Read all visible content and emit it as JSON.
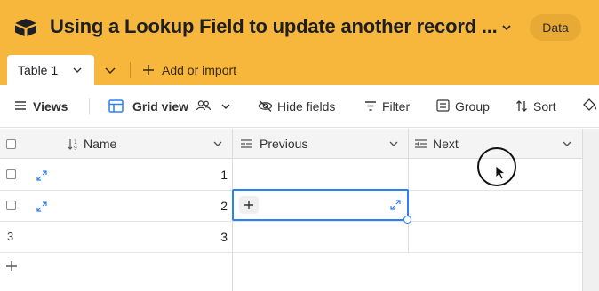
{
  "base": {
    "title": "Using a Lookup Field to update another record ...",
    "data_label": "Data"
  },
  "tabs": {
    "active_label": "Table 1",
    "add_import_label": "Add or import"
  },
  "toolbar": {
    "views_label": "Views",
    "grid_view_label": "Grid view",
    "hide_fields_label": "Hide fields",
    "filter_label": "Filter",
    "group_label": "Group",
    "sort_label": "Sort"
  },
  "grid": {
    "columns": [
      {
        "name": "Name",
        "icon": "number-icon"
      },
      {
        "name": "Previous",
        "icon": "linked-record-icon"
      },
      {
        "name": "Next",
        "icon": "linked-record-icon"
      }
    ],
    "rows": [
      {
        "index": "",
        "name": "1"
      },
      {
        "index": "",
        "name": "2"
      },
      {
        "index": "3",
        "name": "3"
      }
    ]
  },
  "colors": {
    "header": "#f6b73c",
    "accent": "#2d7ff9"
  }
}
